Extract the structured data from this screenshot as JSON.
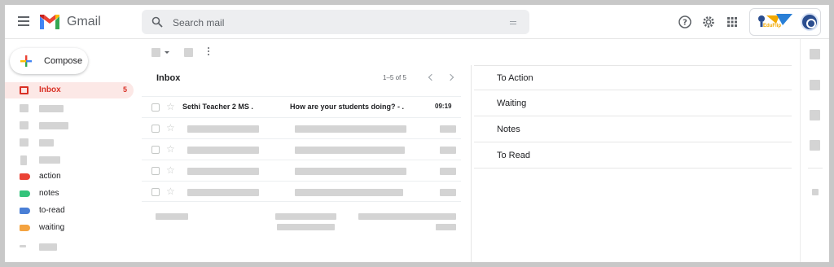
{
  "header": {
    "app_name": "Gmail",
    "search_placeholder": "Search mail",
    "brand_text": "EduFlip"
  },
  "colors": {
    "accent": "#d93025",
    "placeholder_gray": "#d4d4d4",
    "label_action": "#ea4335",
    "label_notes": "#34c37b",
    "label_to_read": "#4a7fd6",
    "label_waiting": "#f4a340"
  },
  "sidebar": {
    "compose_label": "Compose",
    "inbox_label": "Inbox",
    "inbox_count": "5",
    "labels": [
      {
        "name": "action"
      },
      {
        "name": "notes"
      },
      {
        "name": "to-read"
      },
      {
        "name": "waiting"
      }
    ]
  },
  "list": {
    "title": "Inbox",
    "pager_text": "1–5 of 5",
    "first_email": {
      "sender": "Sethi Teacher 2 MS .",
      "subject": "How are your students doing? - .",
      "time": "09:19"
    }
  },
  "sections": [
    {
      "title": "To Action"
    },
    {
      "title": "Waiting"
    },
    {
      "title": "Notes"
    },
    {
      "title": "To Read"
    }
  ],
  "icons": {
    "menu": "hamburger-icon",
    "search": "search-icon",
    "help": "help-icon",
    "settings": "gear-icon",
    "apps": "apps-grid-icon"
  }
}
